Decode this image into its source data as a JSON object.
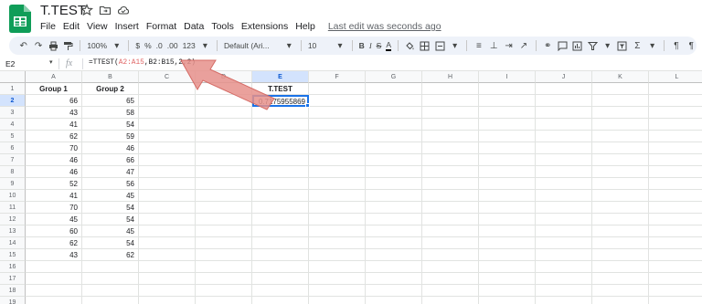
{
  "app": {
    "title": "T.TEST",
    "logo_icon": "sheets-logo-icon",
    "accent_color": "#1a73e8"
  },
  "menu": [
    "File",
    "Edit",
    "View",
    "Insert",
    "Format",
    "Data",
    "Tools",
    "Extensions",
    "Help"
  ],
  "last_edit": "Last edit was seconds ago",
  "toolbar": {
    "zoom": "100%",
    "currency": "$",
    "percent": "%",
    "dec_decrease": ".0",
    "dec_increase": ".00",
    "more_formats": "123",
    "font": "Default (Ari...",
    "font_size": "10",
    "bold": "B",
    "italic": "I",
    "strike": "S",
    "text_color": "A"
  },
  "formula_bar": {
    "name_box": "E2",
    "fx": "fx",
    "formula_prefix": "=TTEST(",
    "range1": "A2:A15",
    "formula_suffix": ",B2:B15,2,2)"
  },
  "columns": [
    "A",
    "B",
    "C",
    "D",
    "E",
    "F",
    "G",
    "H",
    "I",
    "J",
    "K",
    "L"
  ],
  "selected_column": "E",
  "selected_row": 2,
  "rows": [
    "1",
    "2",
    "3",
    "4",
    "5",
    "6",
    "7",
    "8",
    "9",
    "10",
    "11",
    "12",
    "13",
    "14",
    "15",
    "16",
    "17",
    "18",
    "19"
  ],
  "headers": {
    "A1": "Group 1",
    "B1": "Group 2",
    "E1": "T.TEST"
  },
  "group1": [
    "66",
    "43",
    "41",
    "62",
    "70",
    "46",
    "46",
    "52",
    "41",
    "70",
    "45",
    "60",
    "62",
    "43"
  ],
  "group2": [
    "65",
    "58",
    "54",
    "59",
    "46",
    "66",
    "47",
    "56",
    "45",
    "54",
    "54",
    "45",
    "54",
    "62"
  ],
  "result": {
    "cell": "E2",
    "value": "0.7175955869"
  }
}
